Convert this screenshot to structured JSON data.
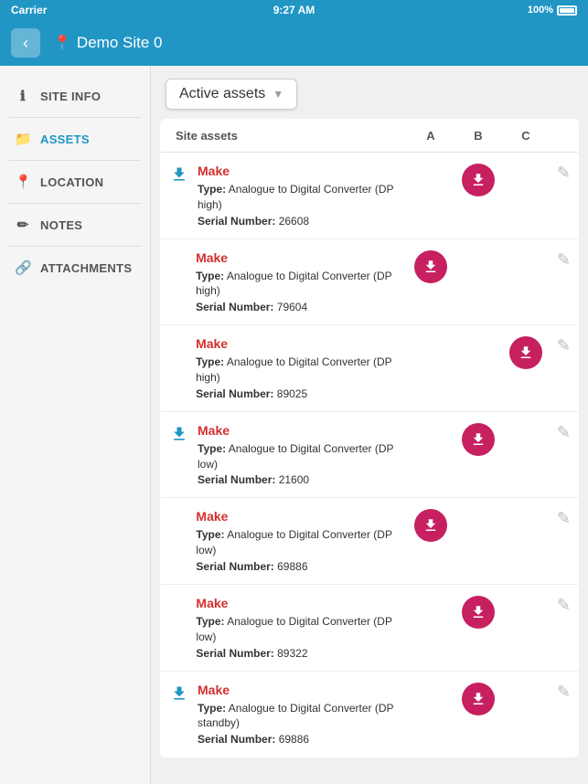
{
  "statusBar": {
    "carrier": "Carrier",
    "time": "9:27 AM",
    "battery": "100%"
  },
  "topNav": {
    "backLabel": "‹",
    "siteTitle": "Demo Site 0",
    "pinIcon": "📍"
  },
  "sidebar": {
    "items": [
      {
        "id": "site-info",
        "label": "SITE INFO",
        "icon": "ℹ",
        "active": false
      },
      {
        "id": "assets",
        "label": "ASSETS",
        "icon": "📁",
        "active": true
      },
      {
        "id": "location",
        "label": "LOCATION",
        "icon": "📍",
        "active": false
      },
      {
        "id": "notes",
        "label": "NOTES",
        "icon": "✏",
        "active": false
      },
      {
        "id": "attachments",
        "label": "ATTACHMENTS",
        "icon": "🔗",
        "active": false
      }
    ]
  },
  "assetsHeader": {
    "tabLabel": "Active assets",
    "dropdownArrow": "▼"
  },
  "table": {
    "columns": [
      "Site assets",
      "A",
      "B",
      "C"
    ],
    "rows": [
      {
        "hasDownloadLeft": true,
        "name": "Make",
        "typeLabel": "Type:",
        "typeValue": "Analogue to Digital Converter (DP high)",
        "serialLabel": "Serial Number:",
        "serialValue": "26608",
        "colA": "",
        "colB": true,
        "colC": "",
        "hasEdit": true
      },
      {
        "hasDownloadLeft": false,
        "name": "Make",
        "typeLabel": "Type:",
        "typeValue": "Analogue to Digital Converter (DP high)",
        "serialLabel": "Serial Number:",
        "serialValue": "79604",
        "colA": true,
        "colB": "",
        "colC": "",
        "hasEdit": true
      },
      {
        "hasDownloadLeft": false,
        "name": "Make",
        "typeLabel": "Type:",
        "typeValue": "Analogue to Digital Converter (DP high)",
        "serialLabel": "Serial Number:",
        "serialValue": "89025",
        "colA": "",
        "colB": "",
        "colC": true,
        "hasEdit": true
      },
      {
        "hasDownloadLeft": true,
        "name": "Make",
        "typeLabel": "Type:",
        "typeValue": "Analogue to Digital Converter (DP low)",
        "serialLabel": "Serial Number:",
        "serialValue": "21600",
        "colA": "",
        "colB": true,
        "colC": "",
        "hasEdit": true
      },
      {
        "hasDownloadLeft": false,
        "name": "Make",
        "typeLabel": "Type:",
        "typeValue": "Analogue to Digital Converter (DP low)",
        "serialLabel": "Serial Number:",
        "serialValue": "69886",
        "colA": true,
        "colB": "",
        "colC": "",
        "hasEdit": true
      },
      {
        "hasDownloadLeft": false,
        "name": "Make",
        "typeLabel": "Type:",
        "typeValue": "Analogue to Digital Converter (DP low)",
        "serialLabel": "Serial Number:",
        "serialValue": "89322",
        "colA": "",
        "colB": true,
        "colC": "",
        "hasEdit": true
      },
      {
        "hasDownloadLeft": true,
        "name": "Make",
        "typeLabel": "Type:",
        "typeValue": "Analogue to Digital Converter (DP standby)",
        "serialLabel": "Serial Number:",
        "serialValue": "69886",
        "colA": "",
        "colB": true,
        "colC": "",
        "hasEdit": true
      }
    ]
  }
}
